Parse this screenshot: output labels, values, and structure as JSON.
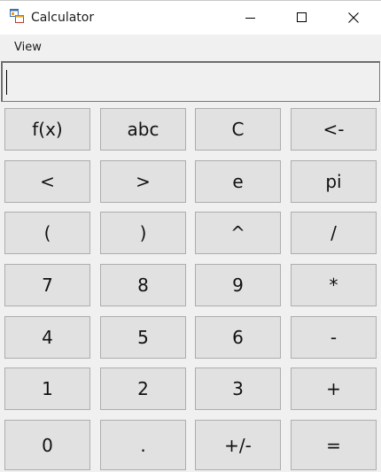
{
  "window": {
    "title": "Calculator",
    "icon": "app-window-icon",
    "controls": {
      "minimize_icon": "minimize-icon",
      "maximize_icon": "maximize-icon",
      "close_icon": "close-icon"
    }
  },
  "menu": {
    "items": [
      "View"
    ]
  },
  "display": {
    "value": "",
    "placeholder": ""
  },
  "keypad": {
    "rows": [
      [
        "f(x)",
        "abc",
        "C",
        "<-"
      ],
      [
        "<",
        ">",
        "e",
        "pi"
      ],
      [
        "(",
        ")",
        "^",
        "/"
      ],
      [
        "7",
        "8",
        "9",
        "*"
      ],
      [
        "4",
        "5",
        "6",
        "-"
      ],
      [
        "1",
        "2",
        "3",
        "+"
      ],
      [
        "0",
        ".",
        "+/-",
        "="
      ]
    ]
  },
  "colors": {
    "button_face": "#e1e1e1",
    "button_border": "#adadad",
    "panel_bg": "#f0f0f0",
    "title_bg": "#ffffff"
  }
}
